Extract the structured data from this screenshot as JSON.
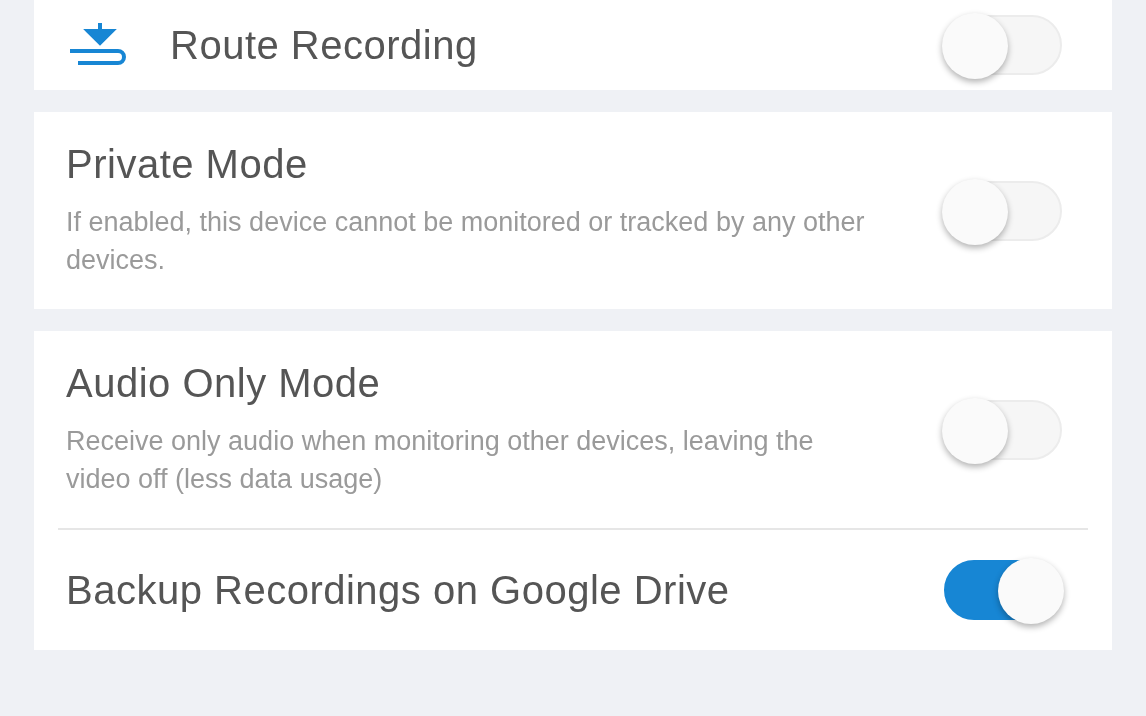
{
  "sections": [
    {
      "items": [
        {
          "kind": "icon-toggle",
          "title": "Route Recording",
          "on": false
        }
      ]
    },
    {
      "items": [
        {
          "kind": "toggle",
          "title": "Private Mode",
          "description": "If enabled, this device cannot be monitored or tracked by any other devices.",
          "on": false
        }
      ]
    },
    {
      "items": [
        {
          "kind": "toggle",
          "title": "Audio Only Mode",
          "description": "Receive only audio when monitoring other devices, leaving the video off (less data usage)",
          "on": false
        },
        {
          "kind": "toggle",
          "title": "Backup Recordings on Google Drive",
          "on": true
        }
      ]
    }
  ]
}
